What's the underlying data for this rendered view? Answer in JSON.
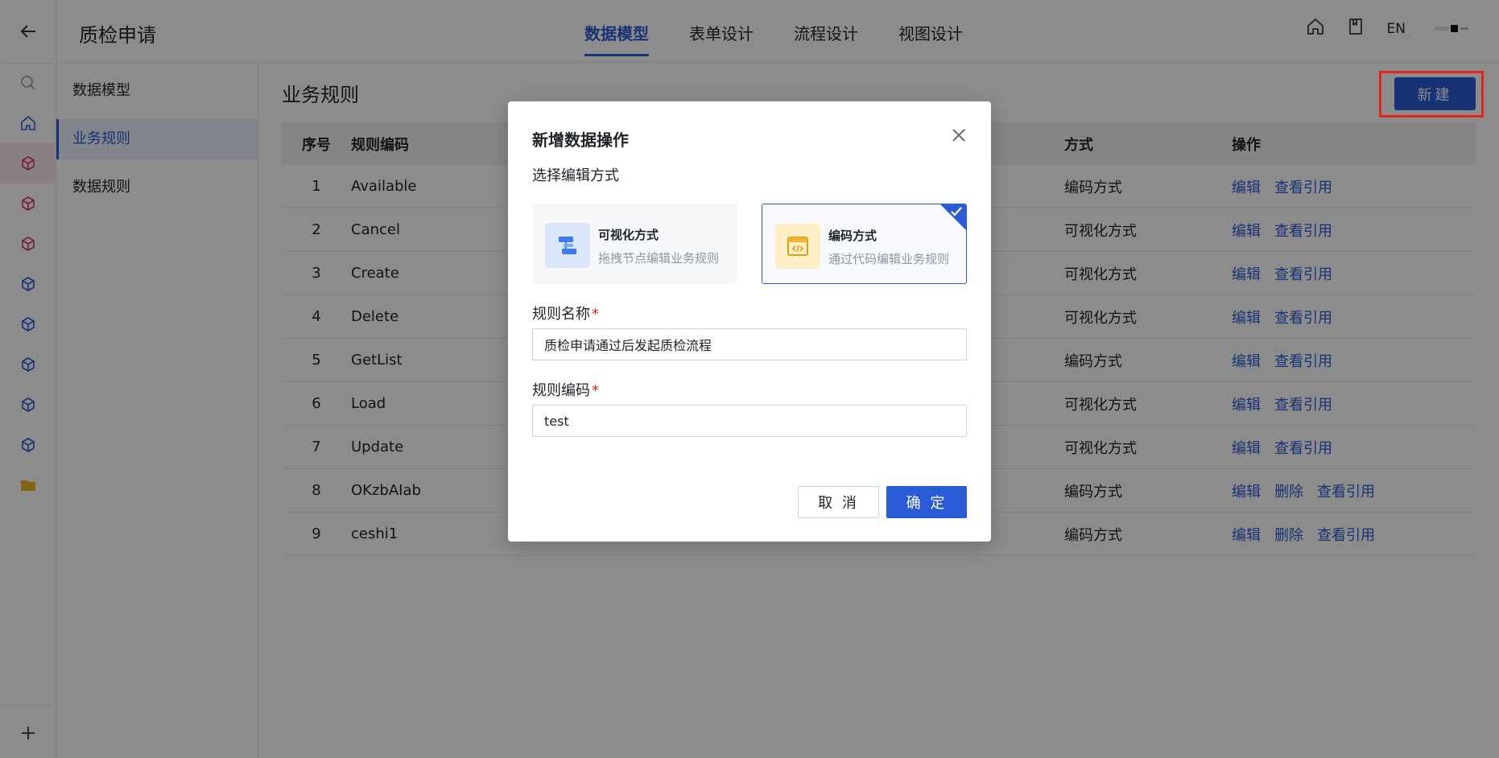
{
  "header": {
    "back_icon": "arrow-left-icon",
    "app_title": "质检申请",
    "tabs": [
      {
        "label": "数据模型",
        "active": true
      },
      {
        "label": "表单设计",
        "active": false
      },
      {
        "label": "流程设计",
        "active": false
      },
      {
        "label": "视图设计",
        "active": false
      }
    ],
    "lang": "EN"
  },
  "rail": {
    "icons": [
      "search-icon",
      "home-icon",
      "cube-icon",
      "cube-icon",
      "cube-icon",
      "cube-icon",
      "cube-icon",
      "cube-icon",
      "cube-icon",
      "cube-icon",
      "folder-icon",
      "plus-icon"
    ]
  },
  "subnav": {
    "items": [
      {
        "label": "数据模型"
      },
      {
        "label": "业务规则"
      },
      {
        "label": "数据规则"
      }
    ],
    "active_index": 1
  },
  "main": {
    "title": "业务规则",
    "new_button": "新建",
    "columns": {
      "no": "序号",
      "code": "规则编码",
      "mode": "方式",
      "ops": "操作"
    },
    "rows": [
      {
        "no": "1",
        "code": "Available",
        "mode": "编码方式",
        "ops": [
          "编辑",
          "查看引用"
        ]
      },
      {
        "no": "2",
        "code": "Cancel",
        "mode": "可视化方式",
        "ops": [
          "编辑",
          "查看引用"
        ]
      },
      {
        "no": "3",
        "code": "Create",
        "mode": "可视化方式",
        "ops": [
          "编辑",
          "查看引用"
        ]
      },
      {
        "no": "4",
        "code": "Delete",
        "mode": "可视化方式",
        "ops": [
          "编辑",
          "查看引用"
        ]
      },
      {
        "no": "5",
        "code": "GetList",
        "mode": "编码方式",
        "ops": [
          "编辑",
          "查看引用"
        ]
      },
      {
        "no": "6",
        "code": "Load",
        "mode": "可视化方式",
        "ops": [
          "编辑",
          "查看引用"
        ]
      },
      {
        "no": "7",
        "code": "Update",
        "mode": "可视化方式",
        "ops": [
          "编辑",
          "查看引用"
        ]
      },
      {
        "no": "8",
        "code": "OKzbAIab",
        "mode": "编码方式",
        "ops": [
          "编辑",
          "删除",
          "查看引用"
        ]
      },
      {
        "no": "9",
        "code": "ceshi1",
        "mode": "编码方式",
        "ops": [
          "编辑",
          "删除",
          "查看引用"
        ]
      }
    ]
  },
  "modal": {
    "title": "新增数据操作",
    "section_label": "选择编辑方式",
    "options": [
      {
        "title": "可视化方式",
        "desc": "拖拽节点编辑业务规则",
        "icon": "flow-nodes-icon",
        "selected": false
      },
      {
        "title": "编码方式",
        "desc": "通过代码编辑业务规则",
        "icon": "code-window-icon",
        "selected": true
      }
    ],
    "name_label": "规则名称",
    "name_value": "质检申请通过后发起质检流程",
    "code_label": "规则编码",
    "code_value": "test",
    "required_mark": "*",
    "cancel": "取 消",
    "ok": "确 定"
  },
  "colors": {
    "accent": "#2b5bd6",
    "highlight": "#e8211c",
    "cube_active": "#d63b6b",
    "cube": "#2b5bd6"
  }
}
